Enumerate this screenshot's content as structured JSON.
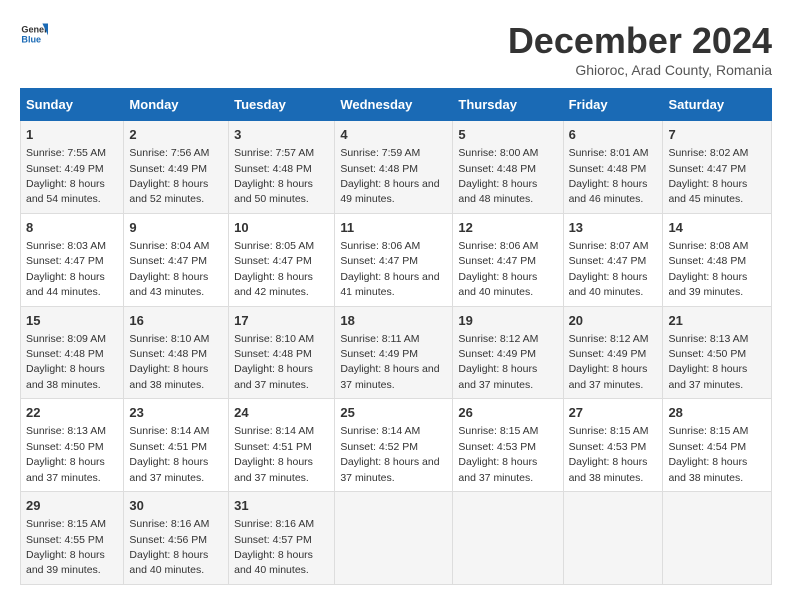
{
  "logo": {
    "line1": "General",
    "line2": "Blue"
  },
  "title": "December 2024",
  "subtitle": "Ghioroc, Arad County, Romania",
  "days_header": [
    "Sunday",
    "Monday",
    "Tuesday",
    "Wednesday",
    "Thursday",
    "Friday",
    "Saturday"
  ],
  "weeks": [
    [
      {
        "num": "1",
        "rise": "7:55 AM",
        "set": "4:49 PM",
        "daylight": "8 hours and 54 minutes."
      },
      {
        "num": "2",
        "rise": "7:56 AM",
        "set": "4:49 PM",
        "daylight": "8 hours and 52 minutes."
      },
      {
        "num": "3",
        "rise": "7:57 AM",
        "set": "4:48 PM",
        "daylight": "8 hours and 50 minutes."
      },
      {
        "num": "4",
        "rise": "7:59 AM",
        "set": "4:48 PM",
        "daylight": "8 hours and 49 minutes."
      },
      {
        "num": "5",
        "rise": "8:00 AM",
        "set": "4:48 PM",
        "daylight": "8 hours and 48 minutes."
      },
      {
        "num": "6",
        "rise": "8:01 AM",
        "set": "4:48 PM",
        "daylight": "8 hours and 46 minutes."
      },
      {
        "num": "7",
        "rise": "8:02 AM",
        "set": "4:47 PM",
        "daylight": "8 hours and 45 minutes."
      }
    ],
    [
      {
        "num": "8",
        "rise": "8:03 AM",
        "set": "4:47 PM",
        "daylight": "8 hours and 44 minutes."
      },
      {
        "num": "9",
        "rise": "8:04 AM",
        "set": "4:47 PM",
        "daylight": "8 hours and 43 minutes."
      },
      {
        "num": "10",
        "rise": "8:05 AM",
        "set": "4:47 PM",
        "daylight": "8 hours and 42 minutes."
      },
      {
        "num": "11",
        "rise": "8:06 AM",
        "set": "4:47 PM",
        "daylight": "8 hours and 41 minutes."
      },
      {
        "num": "12",
        "rise": "8:06 AM",
        "set": "4:47 PM",
        "daylight": "8 hours and 40 minutes."
      },
      {
        "num": "13",
        "rise": "8:07 AM",
        "set": "4:47 PM",
        "daylight": "8 hours and 40 minutes."
      },
      {
        "num": "14",
        "rise": "8:08 AM",
        "set": "4:48 PM",
        "daylight": "8 hours and 39 minutes."
      }
    ],
    [
      {
        "num": "15",
        "rise": "8:09 AM",
        "set": "4:48 PM",
        "daylight": "8 hours and 38 minutes."
      },
      {
        "num": "16",
        "rise": "8:10 AM",
        "set": "4:48 PM",
        "daylight": "8 hours and 38 minutes."
      },
      {
        "num": "17",
        "rise": "8:10 AM",
        "set": "4:48 PM",
        "daylight": "8 hours and 37 minutes."
      },
      {
        "num": "18",
        "rise": "8:11 AM",
        "set": "4:49 PM",
        "daylight": "8 hours and 37 minutes."
      },
      {
        "num": "19",
        "rise": "8:12 AM",
        "set": "4:49 PM",
        "daylight": "8 hours and 37 minutes."
      },
      {
        "num": "20",
        "rise": "8:12 AM",
        "set": "4:49 PM",
        "daylight": "8 hours and 37 minutes."
      },
      {
        "num": "21",
        "rise": "8:13 AM",
        "set": "4:50 PM",
        "daylight": "8 hours and 37 minutes."
      }
    ],
    [
      {
        "num": "22",
        "rise": "8:13 AM",
        "set": "4:50 PM",
        "daylight": "8 hours and 37 minutes."
      },
      {
        "num": "23",
        "rise": "8:14 AM",
        "set": "4:51 PM",
        "daylight": "8 hours and 37 minutes."
      },
      {
        "num": "24",
        "rise": "8:14 AM",
        "set": "4:51 PM",
        "daylight": "8 hours and 37 minutes."
      },
      {
        "num": "25",
        "rise": "8:14 AM",
        "set": "4:52 PM",
        "daylight": "8 hours and 37 minutes."
      },
      {
        "num": "26",
        "rise": "8:15 AM",
        "set": "4:53 PM",
        "daylight": "8 hours and 37 minutes."
      },
      {
        "num": "27",
        "rise": "8:15 AM",
        "set": "4:53 PM",
        "daylight": "8 hours and 38 minutes."
      },
      {
        "num": "28",
        "rise": "8:15 AM",
        "set": "4:54 PM",
        "daylight": "8 hours and 38 minutes."
      }
    ],
    [
      {
        "num": "29",
        "rise": "8:15 AM",
        "set": "4:55 PM",
        "daylight": "8 hours and 39 minutes."
      },
      {
        "num": "30",
        "rise": "8:16 AM",
        "set": "4:56 PM",
        "daylight": "8 hours and 40 minutes."
      },
      {
        "num": "31",
        "rise": "8:16 AM",
        "set": "4:57 PM",
        "daylight": "8 hours and 40 minutes."
      },
      null,
      null,
      null,
      null
    ]
  ]
}
